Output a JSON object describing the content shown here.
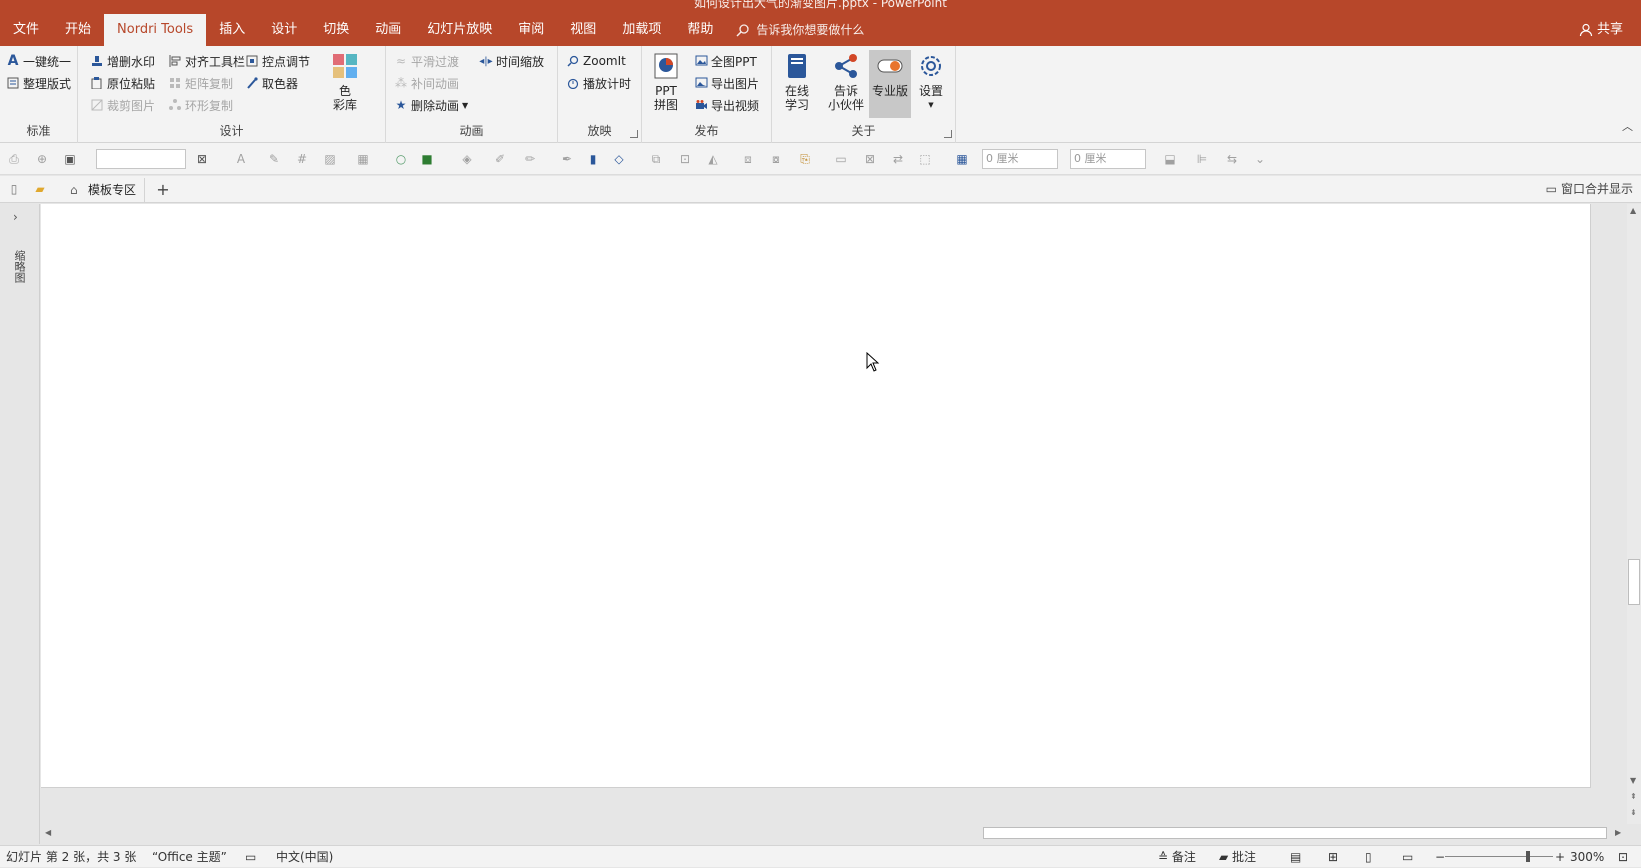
{
  "window": {
    "title": "如何设计出大气的渐变图片.pptx - PowerPoint",
    "controls": "▭  ─  ▭"
  },
  "tabs": [
    "文件",
    "开始",
    "Nordri Tools",
    "插入",
    "设计",
    "切换",
    "动画",
    "幻灯片放映",
    "审阅",
    "视图",
    "加载项",
    "帮助"
  ],
  "active_tab": "Nordri Tools",
  "tell_me": "告诉我你想要做什么",
  "share": "共享",
  "groups": {
    "standard": {
      "label": "标准",
      "items": [
        "一键统一",
        "整理版式"
      ]
    },
    "design": {
      "label": "设计",
      "items": [
        "增删水印",
        "原位粘贴",
        "裁剪图片",
        "对齐工具栏",
        "矩阵复制",
        "环形复制",
        "控点调节",
        "取色器"
      ],
      "color_lib": "色\n彩库"
    },
    "animation": {
      "label": "动画",
      "items": [
        "平滑过渡",
        "补间动画",
        "删除动画",
        "时间缩放"
      ]
    },
    "show": {
      "label": "放映",
      "items": [
        "ZoomIt",
        "播放计时"
      ]
    },
    "publish": {
      "label": "发布",
      "ppt_merge": "PPT\n拼图",
      "items": [
        "全图PPT",
        "导出图片",
        "导出视频"
      ]
    },
    "about": {
      "label": "关于",
      "online": "在线\n学习",
      "tell_friend": "告诉\n小伙伴",
      "pro": "专业版",
      "settings": "设置"
    }
  },
  "format_bar": {
    "width_value": "0 厘米",
    "height_value": "0 厘米"
  },
  "doc_tabs": {
    "template_zone": "模板专区",
    "merge_window": "窗口合并显示"
  },
  "left_pane": {
    "label": "缩略图"
  },
  "status": {
    "slide": "幻灯片 第 2 张，共 3 张",
    "theme": "“Office 主题”",
    "language": "中文(中国)",
    "notes": "备注",
    "comments": "批注",
    "zoom": "300%"
  },
  "colors": {
    "accent": "#b7472a",
    "ribbon_bg": "#f3f3f3"
  }
}
